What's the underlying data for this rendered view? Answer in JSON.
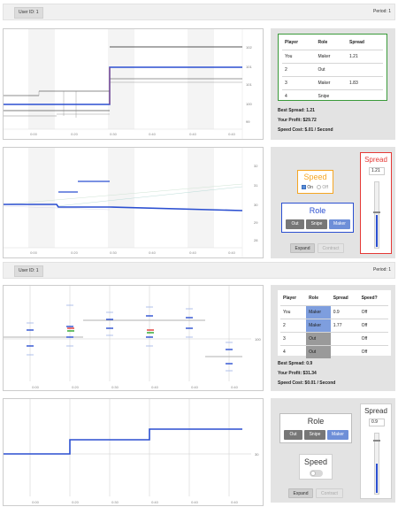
{
  "top": {
    "header": {
      "user_id": "User ID: 1",
      "period": "Period: 1"
    },
    "price_chart": {
      "x_ticks": [
        "0:00",
        "0:20",
        "0:30",
        "0:40",
        "0:40",
        "0:40"
      ],
      "y_ticks": [
        "102",
        "101",
        "101",
        "100",
        "99"
      ]
    },
    "spread_chart": {
      "x_ticks": [
        "0:00",
        "0:20",
        "0:30",
        "0:40",
        "0:40",
        "0:40"
      ],
      "y_ticks": [
        "32",
        "31",
        "30",
        "29",
        "28"
      ]
    },
    "table": {
      "headers": [
        "Player",
        "Role",
        "Spread"
      ],
      "rows": [
        [
          "You",
          "Maker",
          "1.21"
        ],
        [
          "2",
          "Out",
          ""
        ],
        [
          "3",
          "Maker",
          "1.83"
        ],
        [
          "4",
          "Snipe",
          ""
        ]
      ]
    },
    "best_spread": "Best Spread: 1.21",
    "profit": "Your Profit: $29.72",
    "speed_cost": "Speed Cost: $.01 / Second",
    "speed": {
      "title": "Speed",
      "on_label": "On",
      "off_label": "Off"
    },
    "role": {
      "title": "Role",
      "buttons": [
        "Out",
        "Snipe",
        "Maker"
      ],
      "selected": "Maker"
    },
    "spread": {
      "title": "Spread",
      "value": "1.21",
      "slider_level": 0.55
    },
    "expand_label": "Expand",
    "contract_label": "Contract"
  },
  "bottom": {
    "header": {
      "user_id": "User ID: 1",
      "period": "Period: 1"
    },
    "price_chart": {
      "x_ticks": [
        "0:00",
        "0:20",
        "0:30",
        "0:40",
        "0:40",
        "0:40"
      ],
      "y_ticks": [
        "100"
      ]
    },
    "spread_chart": {
      "x_ticks": [
        "0:00",
        "0:20",
        "0:30",
        "0:40",
        "0:40",
        "0:40"
      ],
      "y_ticks": [
        "30"
      ]
    },
    "table": {
      "headers": [
        "Player",
        "Role",
        "Spread",
        "Speed?"
      ],
      "rows": [
        [
          "You",
          "Maker",
          "0.9",
          "Off"
        ],
        [
          "2",
          "Maker",
          "1.77",
          "Off"
        ],
        [
          "3",
          "Out",
          "",
          "Off"
        ],
        [
          "4",
          "Out",
          "",
          "Off"
        ]
      ]
    },
    "best_spread": "Best Spread: 0.9",
    "profit": "Your Profit: $31.34",
    "speed_cost": "Speed Cost: $0.01 / Second",
    "role": {
      "title": "Role",
      "buttons": [
        "Out",
        "Snipe",
        "Maker"
      ],
      "selected": "Maker"
    },
    "speed": {
      "title": "Speed",
      "toggle": "off"
    },
    "spread": {
      "title": "Spread",
      "value": "0.9",
      "slider_level": 0.55
    },
    "expand_label": "Expand",
    "contract_label": "Contract"
  },
  "colors": {
    "accent_blue": "#2b4fd1",
    "maker_blue": "#7e9ede",
    "speed_orange": "#f5a623",
    "spread_red": "#e53935",
    "table_border_green": "#3a9a3a",
    "panel_gray": "#e3e3e3"
  }
}
